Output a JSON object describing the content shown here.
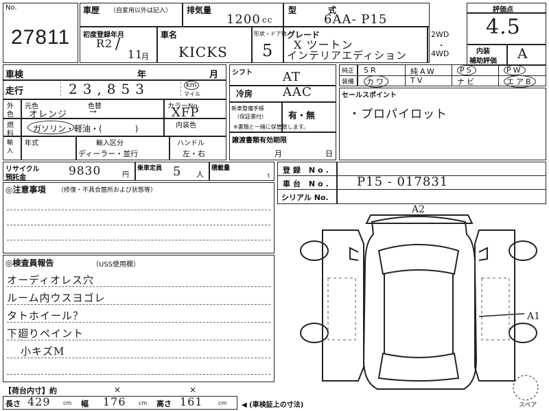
{
  "lot": {
    "no_label": "No.",
    "number": "27811"
  },
  "header": {
    "history_label": "車歴",
    "history_note": "（自家用以外は記入）",
    "displacement_label": "排気量",
    "displacement": "1200",
    "displacement_unit": "cc",
    "model_label": "型",
    "model_label2": "式",
    "model_code": "6AA- P15",
    "score_label": "評価点",
    "score": "4.5"
  },
  "reg": {
    "first_reg_label": "初度登録年月",
    "era": "R2",
    "month": "11",
    "month_unit": "月",
    "name_label": "車名",
    "name": "KICKS",
    "doors_label": "形状・ドア数",
    "doors": "5",
    "grade_label": "グレード",
    "grade_line1": "X ツートン",
    "grade_line2": "インテリアエディション",
    "drive_2wd": "2WD",
    "drive_dot": "・",
    "drive_4wd": "4WD",
    "interior_label1": "内装",
    "interior_label2": "補助評価",
    "interior_score": "A"
  },
  "inspection": {
    "label": "車検",
    "year_label": "年",
    "month_label": "月"
  },
  "mileage": {
    "label": "走行",
    "value": "23,853",
    "unit_km": "km",
    "unit_mile": "マイル"
  },
  "shift": {
    "label": "シフト",
    "value": "AT",
    "ac_label": "冷房",
    "ac_value": "AAC"
  },
  "equipment": {
    "label1": "純正",
    "label2": "装備",
    "items": [
      [
        "SR",
        "純AW",
        "PS",
        "PW"
      ],
      [
        "カワ",
        "TV",
        "ナビ",
        "エアB"
      ]
    ],
    "circled": [
      "カワ",
      "PS",
      "PW",
      "エアB"
    ]
  },
  "color": {
    "label1": "外",
    "label2": "色",
    "orig_label": "元色",
    "change_label": "色替",
    "orig": "オレンジ",
    "arrow": "→",
    "code_label": "カラーNo.",
    "code": "XFP"
  },
  "fuel": {
    "label1": "燃",
    "label2": "料",
    "options": "ガソリン・軽油・(　　　　)",
    "circled": "ガソリン",
    "interior_label": "内装色"
  },
  "import": {
    "label1": "輸",
    "label2": "入",
    "year_label": "年式",
    "class_label": "輸入区分",
    "class_value": "ディーラー・並行",
    "handle_label": "ハンドル",
    "handle_value": "左・右"
  },
  "maintenance": {
    "label1": "新車整備手帳",
    "label2": "（保証書付）",
    "value": "有・無",
    "note": "※書類と一緒に保管致します。"
  },
  "selling": {
    "label": "セールスポイント",
    "text": "・プロパイロット"
  },
  "warranty": {
    "label": "譲渡書類有効期限",
    "month_label": "月",
    "day_label": "日"
  },
  "recycle": {
    "label1": "リサイクル",
    "label2": "預託金",
    "value": "9830",
    "unit": "円",
    "capacity_label": "乗車定員",
    "capacity": "5",
    "capacity_unit": "人",
    "load_label": "積載量",
    "load_unit": "t"
  },
  "ids": {
    "reg_label": "登録 No.",
    "chassis_label": "車台 No.",
    "chassis": "P15 - 017831",
    "serial_label": "シリアル No."
  },
  "notes": {
    "label": "◎注意事項",
    "sub": "（修復・不具合箇所および状態等）"
  },
  "inspector": {
    "label": "◎検査員報告",
    "sub": "（USS使用欄）",
    "lines": [
      "オーディオレス穴",
      "ルーム内ウスヨゴレ",
      "タトホイール？",
      "下廻りペイント",
      "小キズM"
    ]
  },
  "dims": {
    "cargo_label": "【荷台内寸】約",
    "x": "×",
    "length_label": "長さ",
    "length": "429",
    "width_label": "幅",
    "width": "176",
    "height_label": "高さ",
    "height": "161",
    "unit": "cm",
    "note": "◀ (車検証上の寸法)"
  },
  "diagram": {
    "mark_front": "A2",
    "mark_side": "A1",
    "spare_label": "スペア"
  }
}
